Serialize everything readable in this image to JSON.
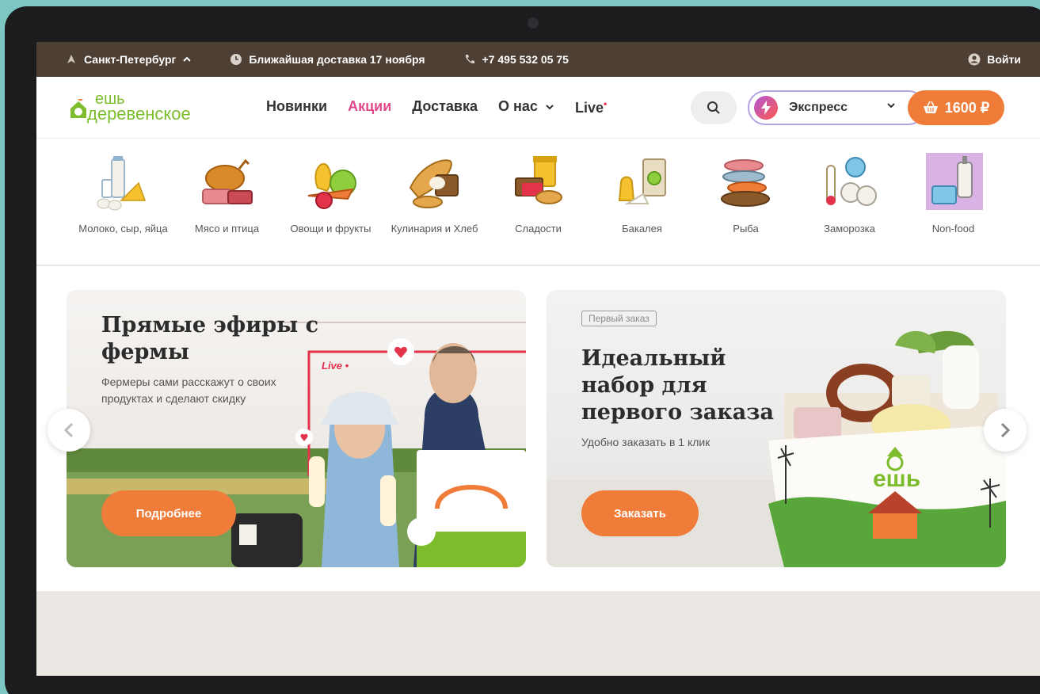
{
  "topbar": {
    "city": "Санкт-Петербург",
    "delivery": "Ближайшая доставка 17 ноября",
    "phone": "+7 495 532 05 75",
    "login": "Войти"
  },
  "logo": {
    "line1": "ешь",
    "line2": "деревенское"
  },
  "nav": {
    "items": [
      "Новинки",
      "Акции",
      "Доставка",
      "О нас",
      "Live"
    ],
    "promo_color": "#e04a8a"
  },
  "header": {
    "express_label": "Экспресс",
    "cart_total": "1600 ₽"
  },
  "categories": [
    {
      "label": "Молоко, сыр, яйца",
      "icon": "milk-cheese-icon"
    },
    {
      "label": "Мясо и птица",
      "icon": "meat-icon"
    },
    {
      "label": "Овощи и фрукты",
      "icon": "vegetables-icon"
    },
    {
      "label": "Кулинария и Хлеб",
      "icon": "bread-icon"
    },
    {
      "label": "Сладости",
      "icon": "sweets-icon"
    },
    {
      "label": "Бакалея",
      "icon": "grocery-icon"
    },
    {
      "label": "Рыба",
      "icon": "fish-icon"
    },
    {
      "label": "Заморозка",
      "icon": "frozen-icon"
    },
    {
      "label": "Non-food",
      "icon": "nonfood-icon"
    }
  ],
  "banners": [
    {
      "title": "Прямые эфиры с фермы",
      "text": "Фермеры сами расскажут о своих продуктах и сделают скидку",
      "button": "Подробнее",
      "live_label": "Live •"
    },
    {
      "tag": "Первый заказ",
      "title": "Идеальный набор для первого заказа",
      "text": "Удобно заказать в 1 клик",
      "button": "Заказать",
      "box_logo": "ешь"
    }
  ],
  "colors": {
    "accent": "#f07c3a",
    "topbar": "#4d3f33",
    "brand_green": "#7dbd2d"
  }
}
